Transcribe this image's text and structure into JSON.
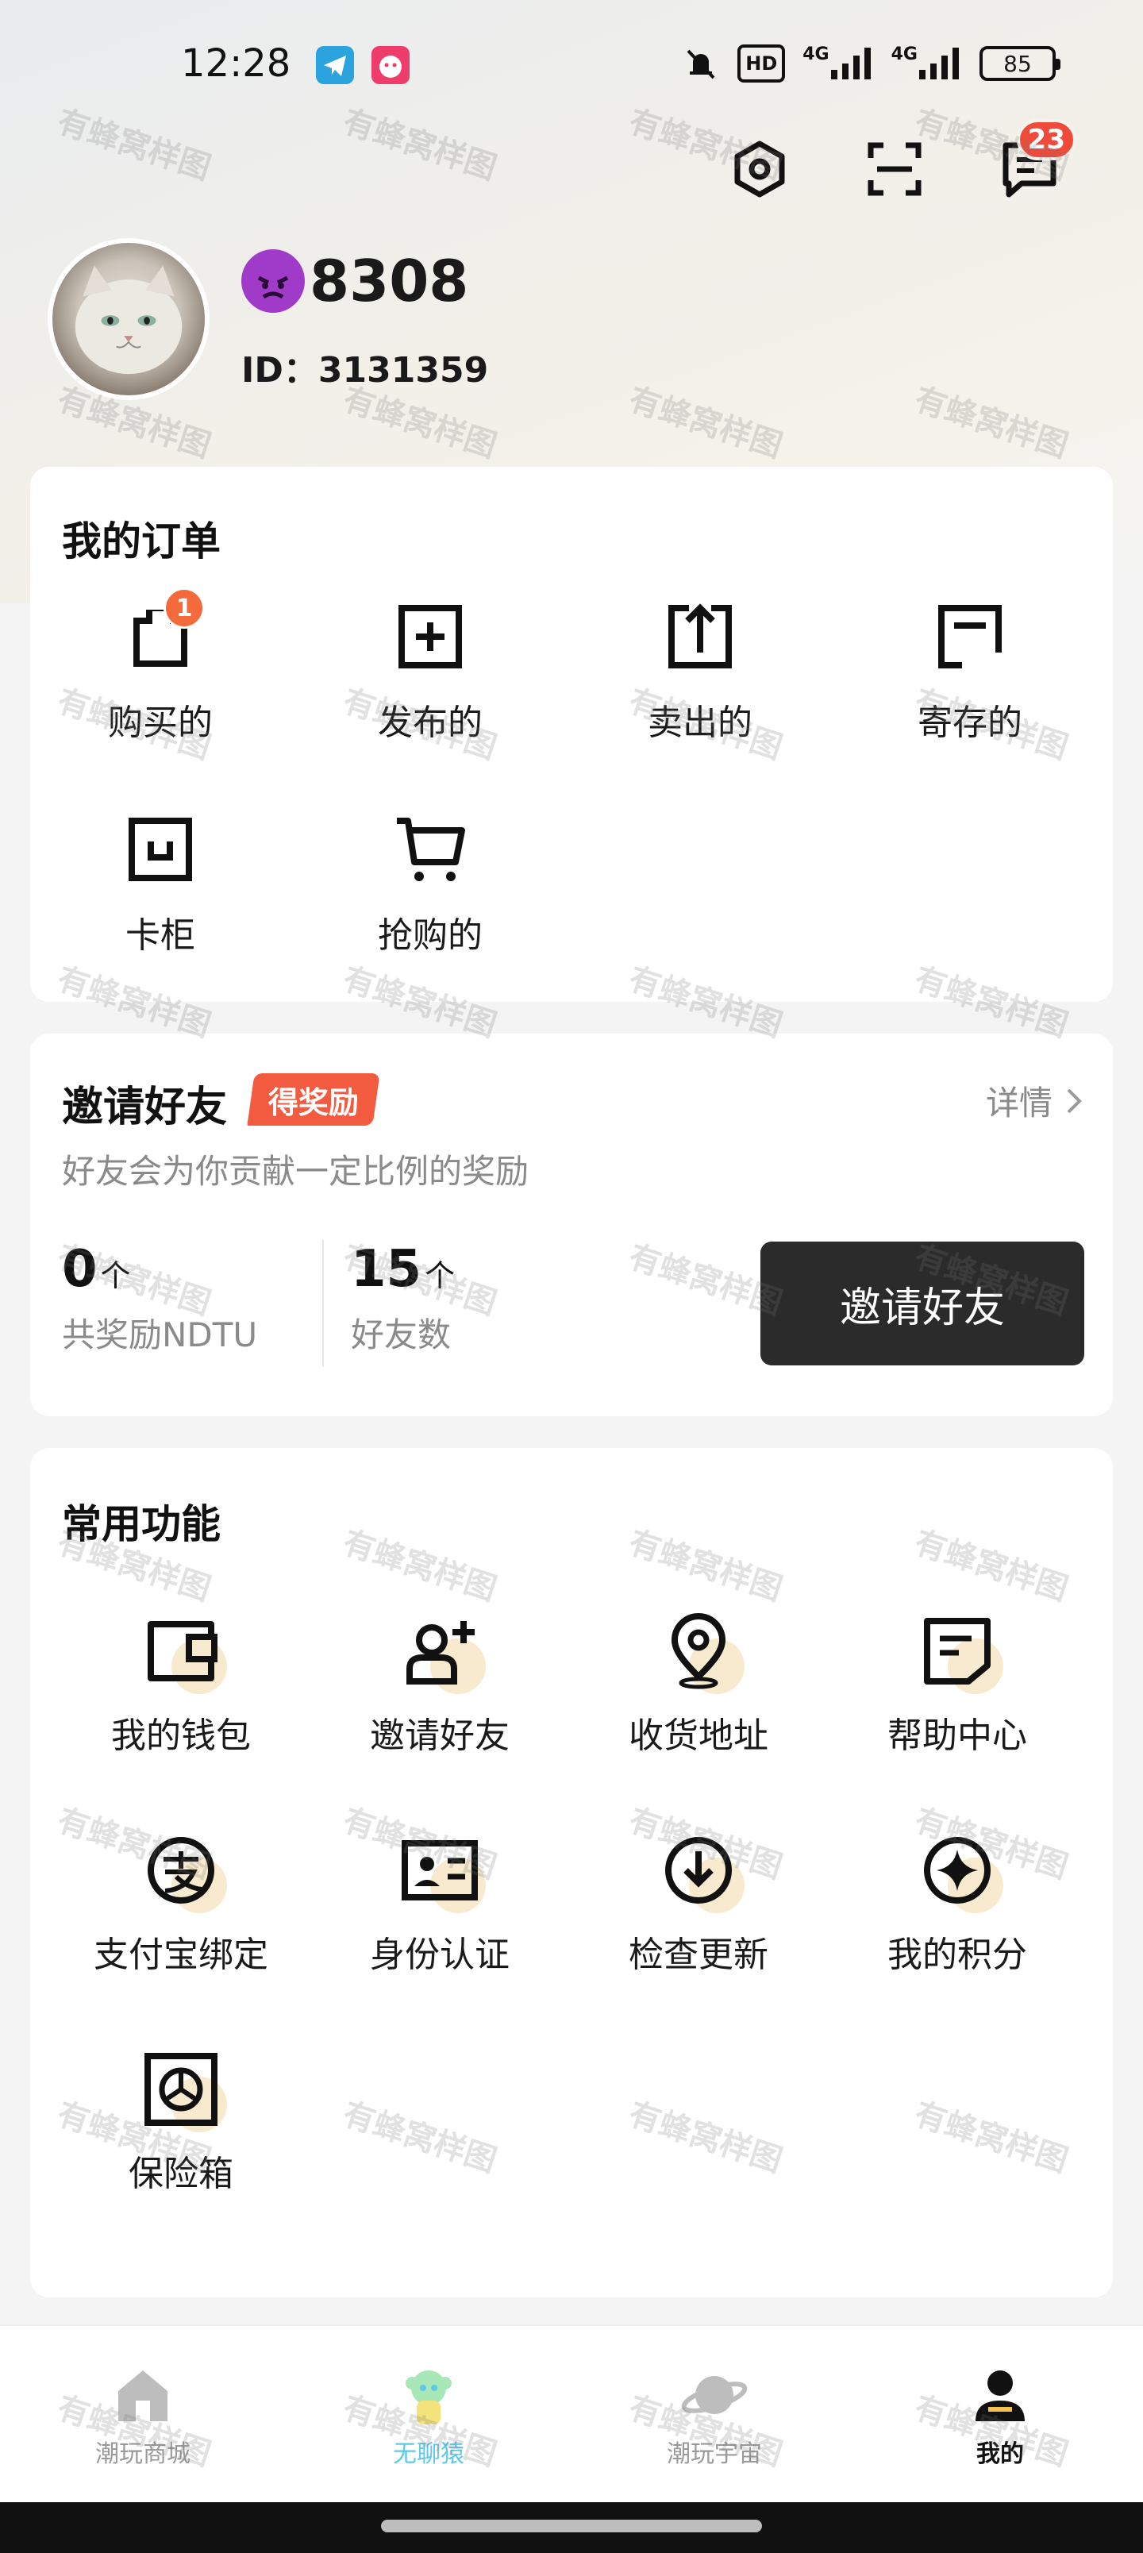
{
  "status_bar": {
    "time": "12:28",
    "network_label": "4G",
    "hd_label": "HD",
    "battery": "85"
  },
  "header": {
    "message_badge": "23"
  },
  "profile": {
    "nickname": "8308",
    "uid": "ID：3131359"
  },
  "orders": {
    "title": "我的订单",
    "items": [
      {
        "label": "购买的",
        "icon": "bag-icon",
        "badge": "1"
      },
      {
        "label": "发布的",
        "icon": "publish-icon"
      },
      {
        "label": "卖出的",
        "icon": "upload-icon"
      },
      {
        "label": "寄存的",
        "icon": "storage-icon"
      },
      {
        "label": "卡柜",
        "icon": "locker-icon"
      },
      {
        "label": "抢购的",
        "icon": "cart-icon"
      }
    ]
  },
  "invite": {
    "title": "邀请好友",
    "tag": "得奖励",
    "detail_label": "详情",
    "subtitle": "好友会为你贡献一定比例的奖励",
    "reward_num": "0",
    "reward_unit": "个",
    "reward_label": "共奖励NDTU",
    "friend_num": "15",
    "friend_unit": "个",
    "friend_label": "好友数",
    "button_label": "邀请好友"
  },
  "functions": {
    "title": "常用功能",
    "items": [
      {
        "label": "我的钱包",
        "icon": "wallet-icon"
      },
      {
        "label": "邀请好友",
        "icon": "add-friend-icon"
      },
      {
        "label": "收货地址",
        "icon": "location-icon"
      },
      {
        "label": "帮助中心",
        "icon": "help-doc-icon"
      },
      {
        "label": "支付宝绑定",
        "icon": "alipay-icon"
      },
      {
        "label": "身份认证",
        "icon": "id-card-icon"
      },
      {
        "label": "检查更新",
        "icon": "download-icon"
      },
      {
        "label": "我的积分",
        "icon": "points-icon"
      },
      {
        "label": "保险箱",
        "icon": "safe-icon"
      }
    ]
  },
  "bottom_nav": {
    "items": [
      {
        "label": "潮玩商城",
        "icon": "home-icon"
      },
      {
        "label": "无聊猿",
        "icon": "ape-icon"
      },
      {
        "label": "潮玩宇宙",
        "icon": "planet-icon"
      },
      {
        "label": "我的",
        "icon": "profile-icon"
      }
    ]
  },
  "watermark": "有蜂窝样图",
  "colors": {
    "accent_red": "#f25b3f",
    "badge_red": "#f04a3a",
    "button_dark": "#2b2b2b",
    "fun_cyan": "#5ec8e8"
  }
}
